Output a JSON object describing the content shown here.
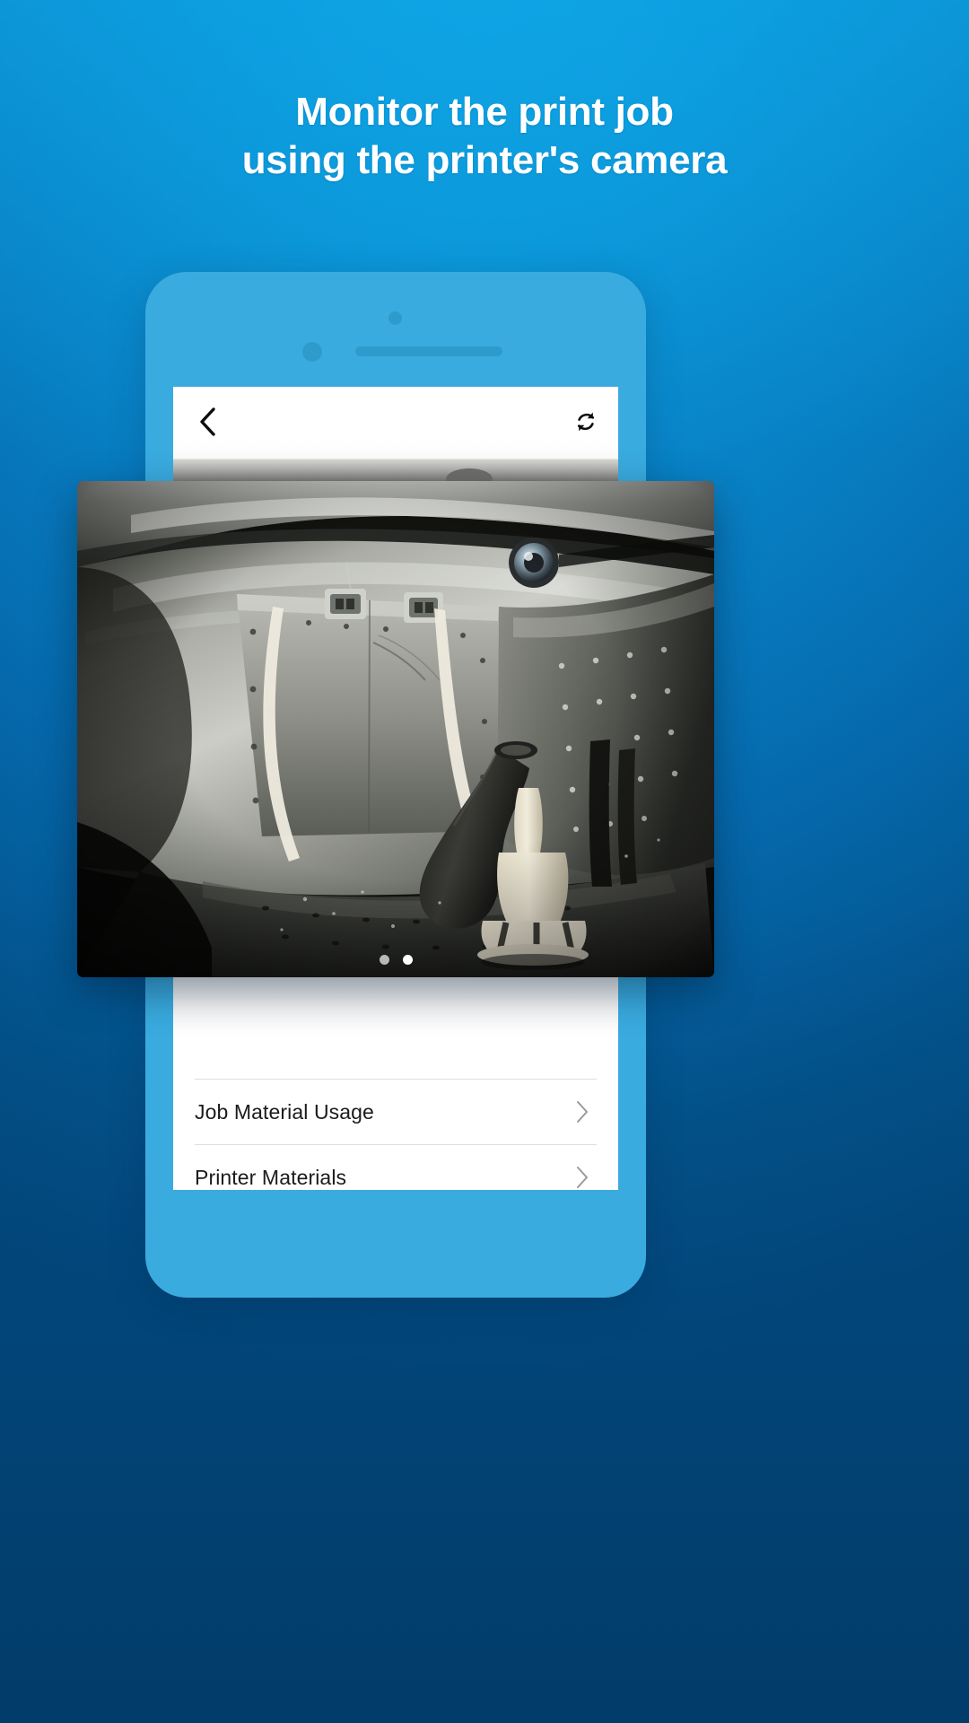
{
  "promo": {
    "headline_line1": "Monitor the print job",
    "headline_line2": "using the printer's camera"
  },
  "colors": {
    "bg_top": "#0ea7e7",
    "bg_bottom": "#024a80",
    "phone_body": "#3aabdf",
    "phone_detail": "#2e9bcd",
    "app_bg": "#ffffff",
    "text_dark": "#1b1b1b",
    "divider": "#dedede",
    "dot_active": "#ffffff",
    "dot_inactive": "#b9b9b9"
  },
  "device": {
    "camera_icon": "front-camera-dot",
    "sensor_icon": "proximity-sensor-dot",
    "speaker_icon": "earpiece-speaker"
  },
  "app": {
    "navbar": {
      "back_icon": "chevron-left-icon",
      "refresh_icon": "refresh-icon"
    },
    "camera_view": {
      "icon": "printer-camera-feed",
      "pager": {
        "total": 2,
        "active_index": 1
      }
    },
    "list": {
      "rows": [
        {
          "label": "Job Material Usage",
          "chevron": "chevron-right-icon"
        },
        {
          "label": "Printer Materials",
          "chevron": "chevron-right-icon"
        }
      ]
    }
  }
}
